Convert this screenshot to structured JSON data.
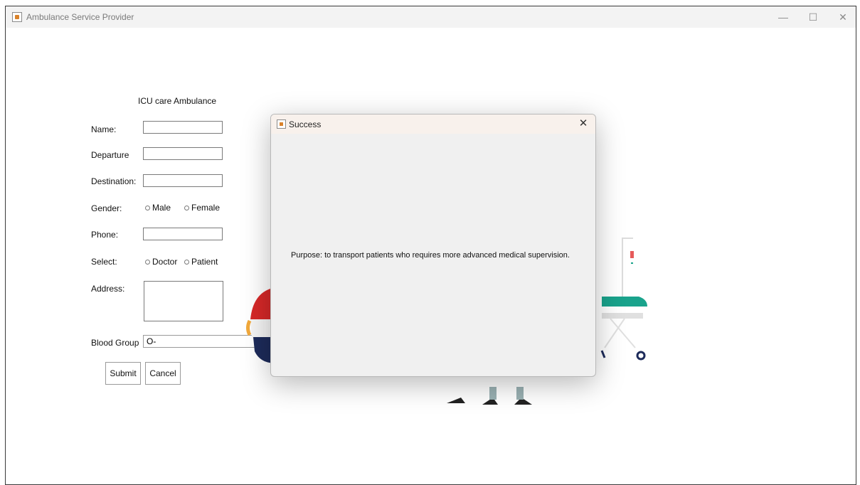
{
  "window": {
    "title": "Ambulance Service Provider",
    "controls": {
      "minimize": "—",
      "maximize": "☐",
      "close": "✕"
    }
  },
  "form": {
    "heading": "ICU care Ambulance",
    "name_label": "Name:",
    "departure_label": "Departure",
    "destination_label": "Destination:",
    "gender_label": "Gender:",
    "gender_options": [
      "Male",
      "Female"
    ],
    "phone_label": "Phone:",
    "select_label": "Select:",
    "select_options": [
      "Doctor",
      "Patient"
    ],
    "address_label": "Address:",
    "blood_group_label": "Blood Group",
    "blood_group_value": "O-",
    "submit_label": "Submit",
    "cancel_label": "Cancel"
  },
  "dialog": {
    "title": "Success",
    "close": "✕",
    "message": "Purpose: to transport patients who requires more advanced medical supervision."
  },
  "colors": {
    "dialog_bg": "#f0f0f0",
    "dialog_title_bg": "#f8f1ec",
    "illustration_red": "#d62828",
    "illustration_navy": "#1d2b5a",
    "illustration_teal": "#1aa38c"
  }
}
